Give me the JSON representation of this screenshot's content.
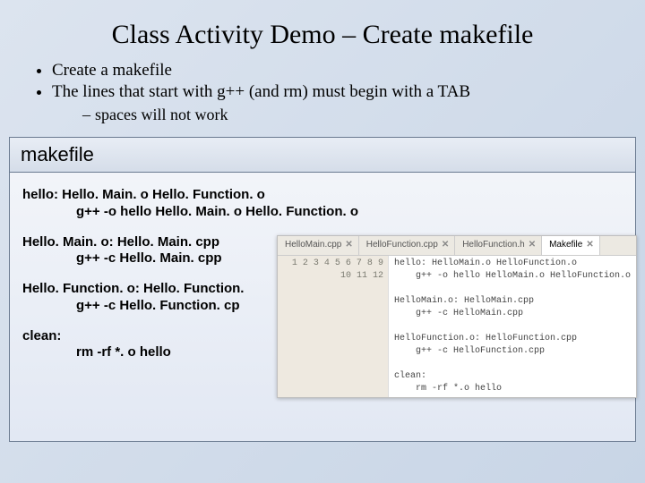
{
  "title": "Class Activity Demo – Create makefile",
  "bullets": {
    "b1a": "Create a makefile",
    "b1b": "The lines that start with g++ (and rm) must begin with a TAB",
    "b2a": "spaces will not work"
  },
  "mk": {
    "header": "makefile",
    "l1": "hello: Hello. Main. o Hello. Function. o",
    "l2": "g++ -o hello Hello. Main. o Hello. Function. o",
    "l3": "Hello. Main. o: Hello. Main. cpp",
    "l4": "g++ -c Hello. Main. cpp",
    "l5": "Hello. Function. o: Hello. Function.",
    "l6": "g++ -c Hello. Function. cp",
    "l7": "clean:",
    "l8": "rm -rf *. o hello"
  },
  "editor": {
    "tabs": {
      "t1": "HelloMain.cpp",
      "t2": "HelloFunction.cpp",
      "t3": "HelloFunction.h",
      "t4": "Makefile"
    },
    "gutter": "1\n2\n3\n4\n5\n6\n7\n8\n9\n10\n11\n12",
    "code": "hello: HelloMain.o HelloFunction.o\n    g++ -o hello HelloMain.o HelloFunction.o\n\nHelloMain.o: HelloMain.cpp\n    g++ -c HelloMain.cpp\n\nHelloFunction.o: HelloFunction.cpp\n    g++ -c HelloFunction.cpp\n\nclean:\n    rm -rf *.o hello\n"
  }
}
